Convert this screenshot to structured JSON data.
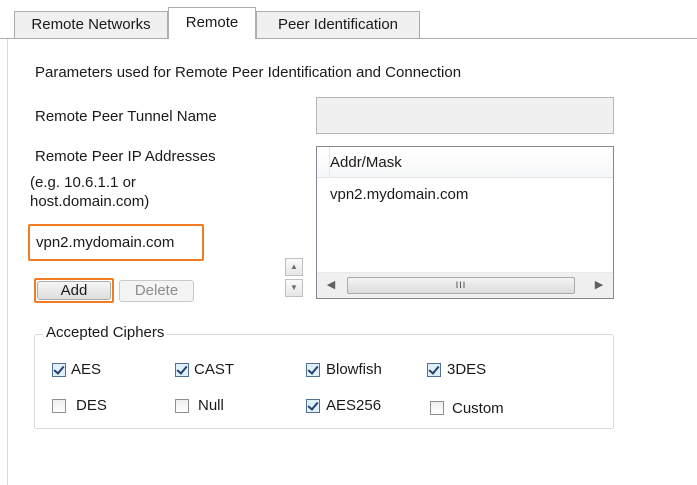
{
  "tabs": [
    {
      "label": "Remote Networks",
      "active": false
    },
    {
      "label": "Remote",
      "active": true
    },
    {
      "label": "Peer Identification",
      "active": false
    }
  ],
  "panel": {
    "description": "Parameters used for Remote Peer Identification and Connection",
    "tunnel_name_label": "Remote Peer Tunnel Name",
    "tunnel_name_value": "",
    "ip_label": "Remote Peer IP Addresses",
    "ip_hint_line1": "(e.g. 10.6.1.1 or",
    "ip_hint_line2": "host.domain.com)",
    "host_input_value": "vpn2.mydomain.com",
    "add_label": "Add",
    "delete_label": "Delete",
    "address_list": {
      "column_header": "Addr/Mask",
      "rows": [
        "vpn2.mydomain.com"
      ],
      "scroll_thumb_glyph": "III"
    }
  },
  "ciphers": {
    "title": "Accepted Ciphers",
    "items": [
      {
        "label": "AES",
        "checked": true
      },
      {
        "label": "CAST",
        "checked": true
      },
      {
        "label": "Blowfish",
        "checked": true
      },
      {
        "label": "3DES",
        "checked": true
      },
      {
        "label": "DES",
        "checked": false
      },
      {
        "label": "Null",
        "checked": false
      },
      {
        "label": "AES256",
        "checked": true
      },
      {
        "label": "Custom",
        "checked": false
      }
    ]
  },
  "colors": {
    "highlight": "#f07d23",
    "tab_border": "#adadad"
  }
}
